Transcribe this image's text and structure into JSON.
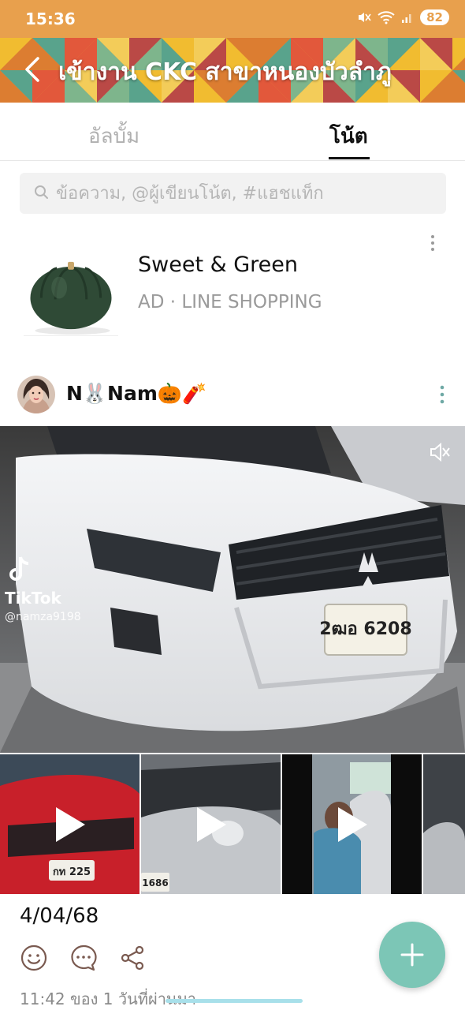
{
  "status_bar": {
    "time": "15:36",
    "battery": "82"
  },
  "header": {
    "title": "เข้างาน CKC สาขาหนองบัวลำภู",
    "back_icon": "chevron-left-icon"
  },
  "tabs": [
    {
      "label": "อัลบั้ม",
      "active": false
    },
    {
      "label": "โน้ต",
      "active": true
    }
  ],
  "search": {
    "placeholder": "ข้อความ, @ผู้เขียนโน้ต, #แฮชแท็ก",
    "value": ""
  },
  "ad": {
    "name": "Sweet & Green",
    "sponsor": "AD · LINE SHOPPING"
  },
  "post": {
    "author": "N🐰Nam🎃🧨",
    "video": {
      "watermark_brand": "TikTok",
      "watermark_handle": "@namza9198",
      "plate": "2ฒอ 6208"
    },
    "thumbnails": [
      {
        "plate": "กท 225"
      },
      {
        "plate": "1686"
      },
      {
        "plate": ""
      },
      {
        "plate": ""
      }
    ],
    "date": "4/04/68",
    "timestamp": "11:42 ของ 1 วันที่ผ่านมา"
  },
  "colors": {
    "status_bar": "#e8a04d",
    "fab": "#7cc6b6",
    "tab_active": "#111111",
    "tab_inactive": "#b0b0b0"
  }
}
